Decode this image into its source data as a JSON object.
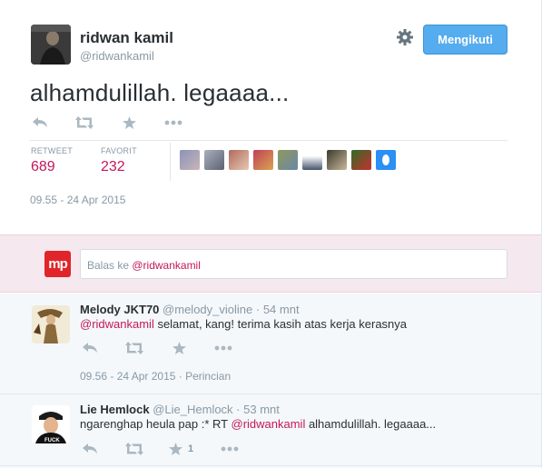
{
  "tweet": {
    "author_name": "ridwan kamil",
    "author_handle": "@ridwankamil",
    "follow_label": "Mengikuti",
    "text": "alhamdulillah. legaaaa...",
    "retweet_label": "RETWEET",
    "retweet_count": "689",
    "favorite_label": "FAVORIT",
    "favorite_count": "232",
    "timestamp": "09.55 - 24 Apr 2015"
  },
  "reply_box": {
    "prefix": "Balas ke ",
    "mention": "@ridwankamil",
    "logo_text": "mp"
  },
  "replies": [
    {
      "name": "Melody JKT70",
      "handle": "@melody_violine",
      "sep": " · ",
      "age": "54 mnt",
      "mention": "@ridwankamil",
      "text": " selamat, kang! terima kasih atas kerja kerasnya",
      "time": "09.56 - 24 Apr 2015",
      "detail": " · Perincian"
    },
    {
      "name": "Lie Hemlock",
      "handle": "@Lie_Hemlock",
      "sep": " · ",
      "age": "53 mnt",
      "text_pre": "ngarenghap heula pap :* RT ",
      "mention": "@ridwankamil",
      "text_post": " alhamdulillah. legaaaa...",
      "fav_count": "1"
    }
  ],
  "icons": {
    "reply": "reply-icon",
    "retweet": "retweet-icon",
    "favorite": "star-icon",
    "more": "more-icon",
    "settings": "gear-icon"
  },
  "colors": {
    "accent": "#c2185b",
    "button": "#55acee",
    "muted": "#8899a6",
    "icon": "#aab8c2"
  }
}
